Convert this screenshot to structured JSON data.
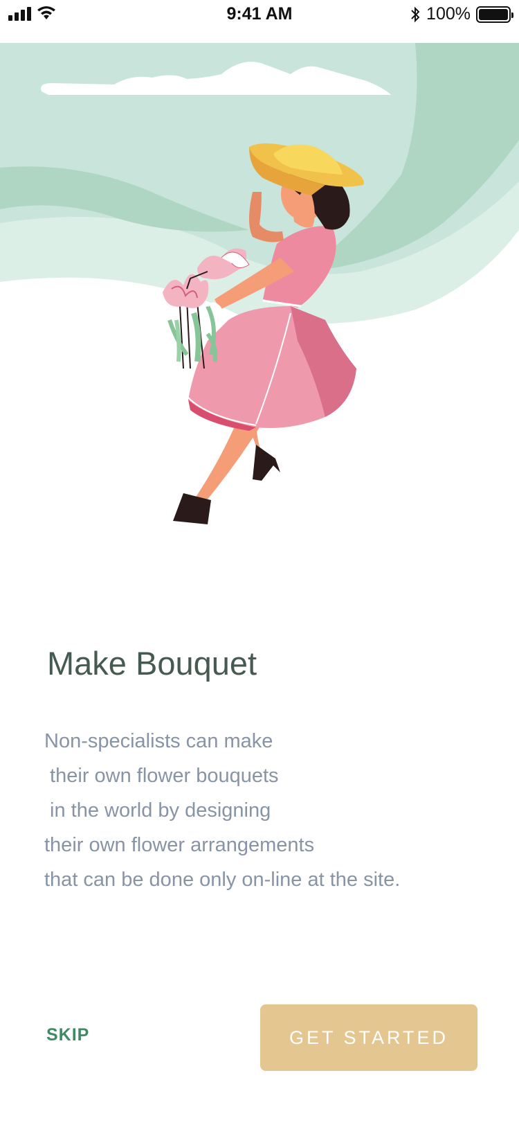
{
  "status_bar": {
    "time": "9:41 AM",
    "battery_percent": "100%",
    "icons": [
      "signal-icon",
      "wifi-icon",
      "bluetooth-icon",
      "battery-icon"
    ]
  },
  "hero": {
    "illustration": "woman-with-bouquet-illustration"
  },
  "onboarding": {
    "title": "Make Bouquet",
    "description_lines": [
      "Non-specialists can make",
      " their own flower bouquets",
      " in the world by designing",
      "their own flower arrangements",
      "that can be done only on-line at the site."
    ]
  },
  "actions": {
    "skip_label": "SKIP",
    "get_started_label": "GET STARTED"
  },
  "colors": {
    "title": "#455a50",
    "description": "#8794a6",
    "skip": "#3d8a63",
    "cta_background": "#e4c690",
    "hero_light_green": "#c8e4db",
    "hero_mid_green": "#aed6c2"
  }
}
